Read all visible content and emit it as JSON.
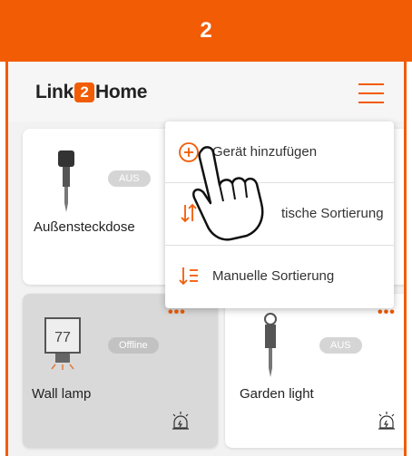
{
  "step": "2",
  "app": {
    "logo_left": "Link",
    "logo_two": "2",
    "logo_right": "Home"
  },
  "devices": [
    {
      "name": "Außensteckdose",
      "status": "AUS"
    },
    {
      "name": "Wall lamp",
      "status": "Offline",
      "display": "77"
    },
    {
      "name": "Garden light",
      "status": "AUS"
    }
  ],
  "menu": {
    "items": [
      {
        "label": "Gerät hinzufügen",
        "icon": "plus-circle-icon"
      },
      {
        "label": "tische Sortierung",
        "icon": "sort-arrows-icon"
      },
      {
        "label": "Manuelle Sortierung",
        "icon": "sort-list-icon"
      }
    ]
  },
  "colors": {
    "accent": "#f25c05",
    "offline_card": "#d9d9d9"
  }
}
